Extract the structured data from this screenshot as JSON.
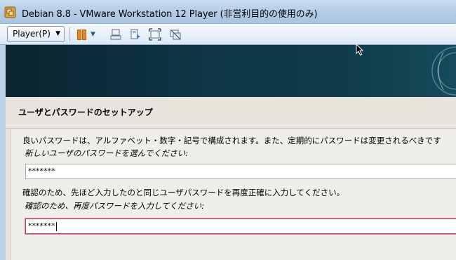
{
  "window": {
    "title": "Debian 8.8 - VMware Workstation 12 Player (非営利目的の使用のみ)",
    "icon": "vmware-player-icon"
  },
  "toolbar": {
    "player_menu_label": "Player(P)",
    "icons": [
      "pause-icon",
      "dropdown-arrow-icon",
      "send-ctrl-alt-del-icon",
      "removable-devices-icon",
      "fullscreen-icon",
      "unity-icon"
    ],
    "pause_color": "#e8891f"
  },
  "installer": {
    "section_title": "ユーザとパスワードのセットアップ",
    "description": "良いパスワードは、アルファベット・数字・記号で構成されます。また、定期的にパスワードは変更されるべきです",
    "password_prompt": "新しいユーザのパスワードを選んでください:",
    "password_value": "*******",
    "confirm_description": "確認のため、先ほど入力したのと同じユーザパスワードを再度正確に入力してください。",
    "confirm_prompt": "確認のため、再度パスワードを入力してください:",
    "confirm_value": "*******"
  }
}
